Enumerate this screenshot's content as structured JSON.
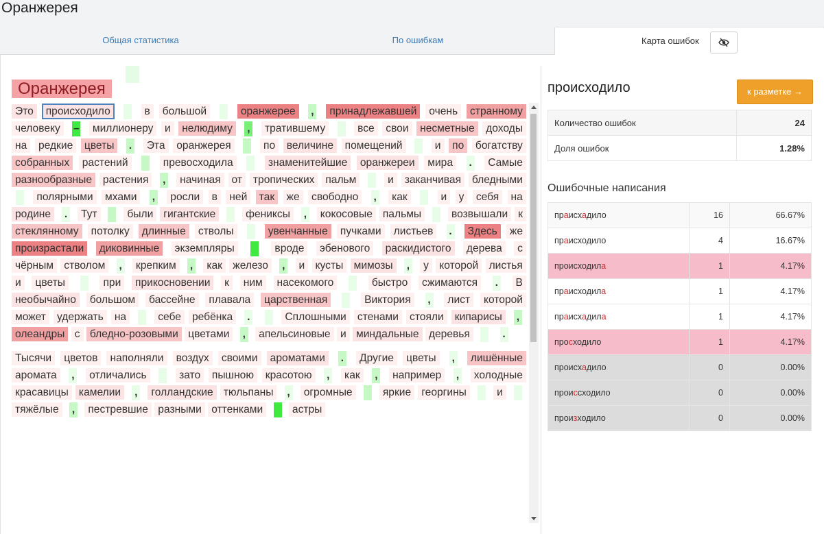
{
  "app": {
    "title": "Оранжерея"
  },
  "tabs": [
    "Общая статистика",
    "По ошибкам",
    "Карта ошибок"
  ],
  "document": {
    "title": "Оранжерея",
    "paragraphs": [
      [
        {
          "t": "Это",
          "h": 1
        },
        {
          "t": "происходило",
          "h": 1,
          "sel": true
        },
        {
          "g": 0
        },
        {
          "t": "в",
          "h": 0
        },
        {
          "t": "большой",
          "h": 0
        },
        {
          "g": 0
        },
        {
          "t": "оранжерее",
          "h": 4
        },
        {
          "g": 1,
          "t": ","
        },
        {
          "t": "принадлежавшей",
          "h": 4
        },
        {
          "t": "очень",
          "h": 0
        },
        {
          "t": "странному",
          "h": 3
        },
        {
          "t": "человеку",
          "h": 0
        },
        {
          "g": 3,
          "t": "–"
        },
        {
          "t": "миллионеру",
          "h": 0
        },
        {
          "t": "и",
          "h": 0
        },
        {
          "t": "нелюдиму",
          "h": 2
        },
        {
          "g": 2,
          "t": ","
        },
        {
          "t": "тратившему",
          "h": 0
        },
        {
          "g": 0
        },
        {
          "t": "все",
          "h": 0
        },
        {
          "t": "свои",
          "h": 0
        },
        {
          "t": "несметные",
          "h": 2
        },
        {
          "t": "доходы",
          "h": 0
        },
        {
          "t": "на",
          "h": 0
        },
        {
          "t": "редкие",
          "h": 0
        },
        {
          "t": "цветы",
          "h": 2
        },
        {
          "g": 1,
          "t": "."
        },
        {
          "t": "Эта",
          "h": 0
        },
        {
          "t": "оранжерея",
          "h": 0
        },
        {
          "g": 1
        },
        {
          "t": "по",
          "h": 0
        },
        {
          "t": "величине",
          "h": 1
        },
        {
          "t": "помещений",
          "h": 0
        },
        {
          "g": 0
        },
        {
          "t": "и",
          "h": 0
        },
        {
          "t": "по",
          "h": 2
        },
        {
          "t": "богатству",
          "h": 0
        },
        {
          "t": "собранных",
          "h": 2
        },
        {
          "t": "растений",
          "h": 0
        },
        {
          "g": 1
        },
        {
          "t": "превосходила",
          "h": 0
        },
        {
          "g": 0
        },
        {
          "t": "знаменитейшие",
          "h": 1
        },
        {
          "t": "оранжереи",
          "h": 1
        },
        {
          "t": "мира",
          "h": 0
        },
        {
          "g": 0,
          "t": "."
        },
        {
          "t": "Самые",
          "h": 0
        },
        {
          "t": "разнообразные",
          "h": 2
        },
        {
          "t": "растения",
          "h": 0
        },
        {
          "g": 1,
          "t": ","
        },
        {
          "t": "начиная",
          "h": 0
        },
        {
          "t": "от",
          "h": 0
        },
        {
          "t": "тропических",
          "h": 0
        },
        {
          "t": "пальм",
          "h": 0
        },
        {
          "g": 0
        },
        {
          "t": "и",
          "h": 0
        },
        {
          "t": "заканчивая",
          "h": 0
        },
        {
          "t": "бледными",
          "h": 0
        },
        {
          "g": 0
        },
        {
          "t": "полярными",
          "h": 0
        },
        {
          "t": "мхами",
          "h": 0
        },
        {
          "g": 1,
          "t": ","
        },
        {
          "t": "росли",
          "h": 0
        },
        {
          "t": "в",
          "h": 0
        },
        {
          "t": "ней",
          "h": 0
        },
        {
          "t": "так",
          "h": 2
        },
        {
          "t": "же",
          "h": 0
        },
        {
          "t": "свободно",
          "h": 0
        },
        {
          "g": 0,
          "t": ","
        },
        {
          "t": "как",
          "h": 0
        },
        {
          "g": 0
        },
        {
          "t": "и",
          "h": 0
        },
        {
          "t": "у",
          "h": 0
        },
        {
          "t": "себя",
          "h": 0
        },
        {
          "t": "на",
          "h": 0
        },
        {
          "t": "родине",
          "h": 1
        },
        {
          "g": 0,
          "t": "."
        },
        {
          "t": "Тут",
          "h": 0
        },
        {
          "g": 1
        },
        {
          "t": "были",
          "h": 0
        },
        {
          "t": "гигантские",
          "h": 1
        },
        {
          "g": 0
        },
        {
          "t": "фениксы",
          "h": 0
        },
        {
          "g": 0,
          "t": ","
        },
        {
          "t": "кокосовые",
          "h": 0
        },
        {
          "t": "пальмы",
          "h": 0
        },
        {
          "g": 0
        },
        {
          "t": "возвышали",
          "h": 0
        },
        {
          "t": "к",
          "h": 0
        },
        {
          "t": "стеклянному",
          "h": 2
        },
        {
          "t": "потолку",
          "h": 0
        },
        {
          "t": "длинные",
          "h": 2
        },
        {
          "t": "стволы",
          "h": 0
        },
        {
          "g": 0
        },
        {
          "t": "увенчанные",
          "h": 3
        },
        {
          "t": "пучками",
          "h": 0
        },
        {
          "t": "листьев",
          "h": 0
        },
        {
          "g": 0,
          "t": "."
        },
        {
          "t": "Здесь",
          "h": 4
        },
        {
          "t": "же",
          "h": 0
        },
        {
          "t": "произрастали",
          "h": 4
        },
        {
          "t": "диковинные",
          "h": 3
        },
        {
          "t": "экземпляры",
          "h": 0
        },
        {
          "g": 3
        },
        {
          "t": "вроде",
          "h": 0
        },
        {
          "t": "эбенового",
          "h": 0
        },
        {
          "t": "раскидистого",
          "h": 1
        },
        {
          "t": "дерева",
          "h": 0
        },
        {
          "t": "с",
          "h": 0
        },
        {
          "t": "чёрным",
          "h": 0
        },
        {
          "t": "стволом",
          "h": 0
        },
        {
          "g": 0,
          "t": ","
        },
        {
          "t": "крепким",
          "h": 0
        },
        {
          "g": 1,
          "t": ","
        },
        {
          "t": "как",
          "h": 0
        },
        {
          "t": "железо",
          "h": 0
        },
        {
          "g": 1,
          "t": ","
        },
        {
          "t": "и",
          "h": 0
        },
        {
          "t": "кусты",
          "h": 0
        },
        {
          "t": "мимозы",
          "h": 1
        },
        {
          "g": 0,
          "t": ","
        },
        {
          "t": "у",
          "h": 0
        },
        {
          "t": "которой",
          "h": 0
        },
        {
          "t": "листья",
          "h": 0
        },
        {
          "t": "и",
          "h": 0
        },
        {
          "t": "цветы",
          "h": 0
        },
        {
          "g": 0
        },
        {
          "t": "при",
          "h": 0
        },
        {
          "t": "прикосновении",
          "h": 1
        },
        {
          "t": "к",
          "h": 0
        },
        {
          "t": "ним",
          "h": 0
        },
        {
          "t": "насекомого",
          "h": 0
        },
        {
          "g": 0
        },
        {
          "t": "быстро",
          "h": 0
        },
        {
          "t": "сжимаются",
          "h": 0
        },
        {
          "g": 0,
          "t": "."
        },
        {
          "t": "В",
          "h": 0
        },
        {
          "t": "необычайно",
          "h": 1
        },
        {
          "t": "большом",
          "h": 0
        },
        {
          "t": "бассейне",
          "h": 0
        },
        {
          "t": "плавала",
          "h": 0
        },
        {
          "t": "царственная",
          "h": 2
        },
        {
          "g": 0
        },
        {
          "t": "Виктория",
          "h": 0
        },
        {
          "g": 0,
          "t": ","
        },
        {
          "t": "лист",
          "h": 0
        },
        {
          "t": "которой",
          "h": 0
        },
        {
          "t": "может",
          "h": 0
        },
        {
          "t": "удержать",
          "h": 0
        },
        {
          "t": "на",
          "h": 0
        },
        {
          "g": 0
        },
        {
          "t": "себе",
          "h": 0
        },
        {
          "t": "ребёнка",
          "h": 0
        },
        {
          "g": 0,
          "t": "."
        },
        {
          "g": 0
        },
        {
          "t": "Сплошными",
          "h": 0
        },
        {
          "t": "стенами",
          "h": 0
        },
        {
          "t": "стояли",
          "h": 0
        },
        {
          "t": "кипарисы",
          "h": 1
        },
        {
          "g": 1,
          "t": ","
        },
        {
          "t": "олеандры",
          "h": 3
        },
        {
          "t": "с",
          "h": 0
        },
        {
          "t": "бледно-розовыми",
          "h": 2
        },
        {
          "t": "цветами",
          "h": 0
        },
        {
          "g": 1,
          "t": ","
        },
        {
          "t": "апельсиновые",
          "h": 0
        },
        {
          "t": "и",
          "h": 0
        },
        {
          "t": "миндальные",
          "h": 1
        },
        {
          "t": "деревья",
          "h": 0
        },
        {
          "g": 0
        },
        {
          "g": 0,
          "t": "."
        }
      ],
      [
        {
          "t": "Тысячи",
          "h": 0
        },
        {
          "t": "цветов",
          "h": 0
        },
        {
          "t": "наполняли",
          "h": 0
        },
        {
          "t": "воздух",
          "h": 0
        },
        {
          "t": "своими",
          "h": 0
        },
        {
          "t": "ароматами",
          "h": 1
        },
        {
          "g": 1,
          "t": "."
        },
        {
          "t": "Другие",
          "h": 0
        },
        {
          "t": "цветы",
          "h": 0
        },
        {
          "g": 0,
          "t": ","
        },
        {
          "t": "лишённые",
          "h": 2
        },
        {
          "t": "аромата",
          "h": 0
        },
        {
          "g": 0,
          "t": ","
        },
        {
          "t": "отличались",
          "h": 0
        },
        {
          "g": 0
        },
        {
          "t": "зато",
          "h": 0
        },
        {
          "t": "пышною",
          "h": 0
        },
        {
          "t": "красотою",
          "h": 0
        },
        {
          "g": 0,
          "t": ","
        },
        {
          "t": "как",
          "h": 0
        },
        {
          "g": 1,
          "t": ","
        },
        {
          "t": "например",
          "h": 0
        },
        {
          "g": 0,
          "t": ","
        },
        {
          "t": "холодные",
          "h": 0
        },
        {
          "t": "красавицы",
          "h": 0
        },
        {
          "t": "камелии",
          "h": 1
        },
        {
          "g": 0,
          "t": ","
        },
        {
          "t": "голландские",
          "h": 1
        },
        {
          "t": "тюльпаны",
          "h": 0
        },
        {
          "g": 0,
          "t": ","
        },
        {
          "t": "огромные",
          "h": 0
        },
        {
          "g": 1
        },
        {
          "t": "яркие",
          "h": 0
        },
        {
          "t": "георгины",
          "h": 0
        },
        {
          "g": 0
        },
        {
          "t": "и",
          "h": 0
        },
        {
          "g": 0
        },
        {
          "t": "тяжёлые",
          "h": 0
        },
        {
          "g": 1,
          "t": ","
        },
        {
          "t": "пестревшие",
          "h": 0
        },
        {
          "t": "разными",
          "h": 0
        },
        {
          "t": "оттенками",
          "h": 0
        },
        {
          "g": 3
        },
        {
          "t": "астры",
          "h": 0
        }
      ]
    ]
  },
  "sidebar": {
    "word": "происходило",
    "markup_button": "к разметке →",
    "stats": [
      {
        "label": "Количество ошибок",
        "value": "24"
      },
      {
        "label": "Доля ошибок",
        "value": "1.28%"
      }
    ],
    "spellings_heading": "Ошибочные написания",
    "spellings": [
      {
        "parts": [
          [
            "пр",
            0
          ],
          [
            "а",
            1
          ],
          [
            "исх",
            0
          ],
          [
            "а",
            1
          ],
          [
            "дило",
            0
          ]
        ],
        "count": "16",
        "percent": "66.67%",
        "style": "alt"
      },
      {
        "parts": [
          [
            "пр",
            0
          ],
          [
            "а",
            1
          ],
          [
            "исходило",
            0
          ]
        ],
        "count": "4",
        "percent": "16.67%",
        "style": "white"
      },
      {
        "parts": [
          [
            "происходил",
            0
          ],
          [
            "а",
            1
          ]
        ],
        "count": "1",
        "percent": "4.17%",
        "style": "pink"
      },
      {
        "parts": [
          [
            "пр",
            0
          ],
          [
            "а",
            1
          ],
          [
            "исходил",
            0
          ],
          [
            "а",
            1
          ]
        ],
        "count": "1",
        "percent": "4.17%",
        "style": "white"
      },
      {
        "parts": [
          [
            "пр",
            0
          ],
          [
            "а",
            1
          ],
          [
            "исх",
            0
          ],
          [
            "а",
            1
          ],
          [
            "дил",
            0
          ],
          [
            "а",
            1
          ]
        ],
        "count": "1",
        "percent": "4.17%",
        "style": "white"
      },
      {
        "parts": [
          [
            "про",
            0
          ],
          [
            "с",
            1
          ],
          [
            "ходило",
            0
          ]
        ],
        "count": "1",
        "percent": "4.17%",
        "style": "pink"
      },
      {
        "parts": [
          [
            "происх",
            0
          ],
          [
            "а",
            1
          ],
          [
            "дило",
            0
          ]
        ],
        "count": "0",
        "percent": "0.00%",
        "style": "grey"
      },
      {
        "parts": [
          [
            "прои",
            0
          ],
          [
            "с",
            1
          ],
          [
            "сходило",
            0
          ]
        ],
        "count": "0",
        "percent": "0.00%",
        "style": "grey"
      },
      {
        "parts": [
          [
            "прои",
            0
          ],
          [
            "з",
            1
          ],
          [
            "ходило",
            0
          ]
        ],
        "count": "0",
        "percent": "0.00%",
        "style": "grey"
      }
    ]
  }
}
